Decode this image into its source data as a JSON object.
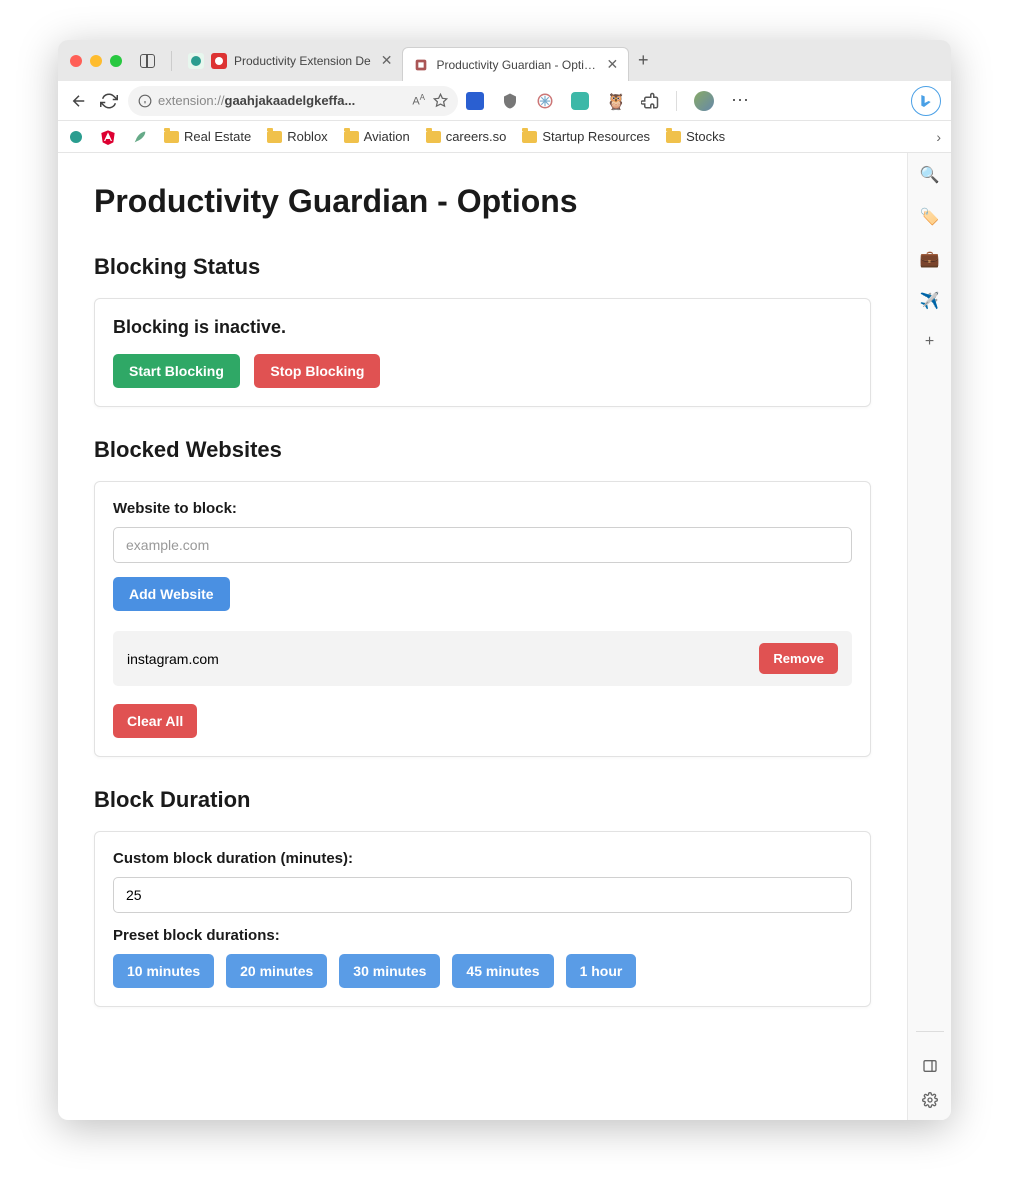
{
  "browser": {
    "tabs": [
      {
        "title": "Productivity Extension De",
        "favicon_bg": "#e7f7ee",
        "favicon_inner": "rec"
      },
      {
        "title": "Productivity Guardian - Options",
        "active": true
      }
    ],
    "address": {
      "prefix": "extension://",
      "bold": "gaahjakaadelgkeffa...",
      "info_icon": "info"
    },
    "bookmarks": [
      {
        "label": "",
        "icon": "openai"
      },
      {
        "label": "",
        "icon": "angular"
      },
      {
        "label": "",
        "icon": "feather"
      },
      {
        "label": "Real Estate",
        "icon": "folder"
      },
      {
        "label": "Roblox",
        "icon": "folder"
      },
      {
        "label": "Aviation",
        "icon": "folder"
      },
      {
        "label": "careers.so",
        "icon": "folder"
      },
      {
        "label": "Startup Resources",
        "icon": "folder"
      },
      {
        "label": "Stocks",
        "icon": "folder"
      }
    ]
  },
  "page": {
    "title": "Productivity Guardian - Options",
    "status": {
      "heading": "Blocking Status",
      "text": "Blocking is inactive.",
      "start_label": "Start Blocking",
      "stop_label": "Stop Blocking"
    },
    "blocked": {
      "heading": "Blocked Websites",
      "input_label": "Website to block:",
      "input_placeholder": "example.com",
      "add_label": "Add Website",
      "sites": [
        {
          "domain": "instagram.com",
          "remove_label": "Remove"
        }
      ],
      "clear_label": "Clear All"
    },
    "duration": {
      "heading": "Block Duration",
      "custom_label": "Custom block duration (minutes):",
      "custom_value": "25",
      "preset_label": "Preset block durations:",
      "presets": [
        "10 minutes",
        "20 minutes",
        "30 minutes",
        "45 minutes",
        "1 hour"
      ]
    }
  }
}
